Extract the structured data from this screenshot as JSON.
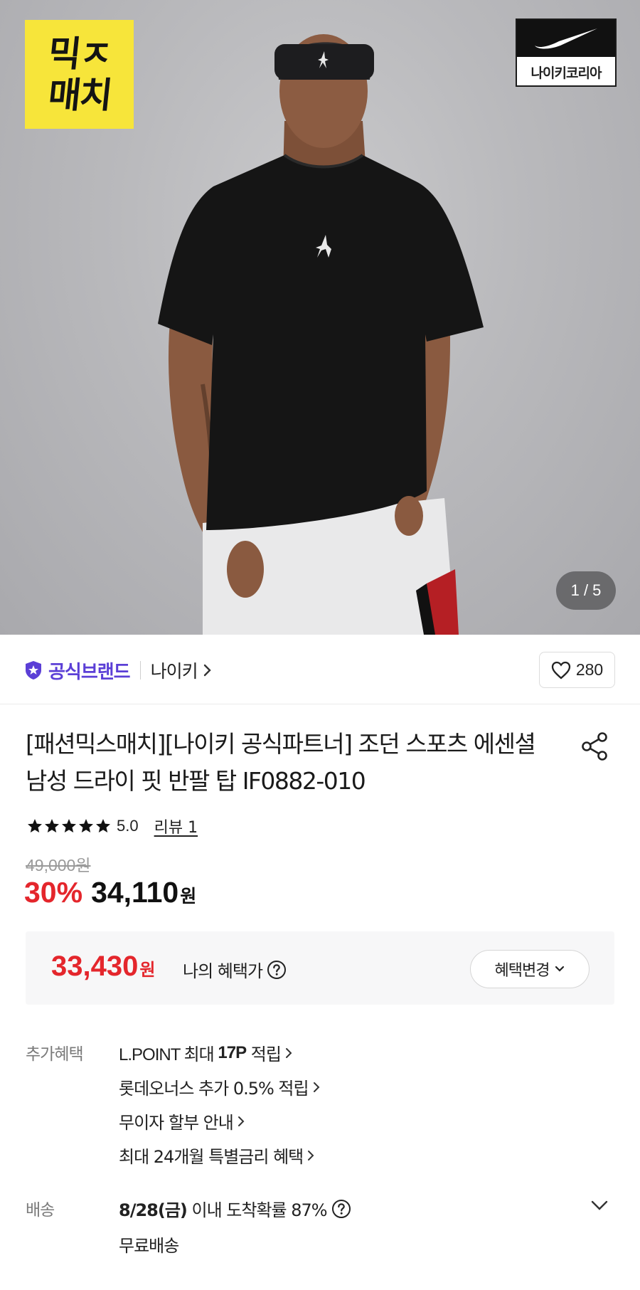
{
  "hero": {
    "mix_badge": {
      "line1": "믹ㅈ",
      "line2": "매치"
    },
    "nike_badge_label": "나이키코리아",
    "counter": "1 / 5"
  },
  "brand": {
    "official_label": "공식브랜드",
    "name": "나이키",
    "like_count": "280",
    "official_color": "#5b3fd6"
  },
  "product": {
    "title": "[패션믹스매치][나이키 공식파트너] 조던 스포츠 에센셜 남성 드라이 핏 반팔 탑 IF0882-010",
    "rating_value": "5.0",
    "review_label": "리뷰 1",
    "star_count": 5,
    "original_price": "49,000원",
    "discount": "30%",
    "sale_price": "34,110",
    "sale_price_unit": "원"
  },
  "benefit": {
    "price": "33,430",
    "price_unit": "원",
    "label": "나의 혜택가",
    "change_button": "혜택변경",
    "accent_color": "#e4262c"
  },
  "extra_benefits": {
    "label": "추가혜택",
    "items": {
      "lpoint_prefix": "L.POINT 최대 ",
      "lpoint_points": "17P",
      "lpoint_suffix": " 적립",
      "item2": "롯데오너스 추가 0.5% 적립",
      "item3": "무이자 할부 안내",
      "item4": "최대 24개월 특별금리 혜택"
    }
  },
  "shipping": {
    "label": "배송",
    "date": "8/28(금)",
    "text": " 이내 도착확률 87%",
    "free": "무료배송"
  }
}
